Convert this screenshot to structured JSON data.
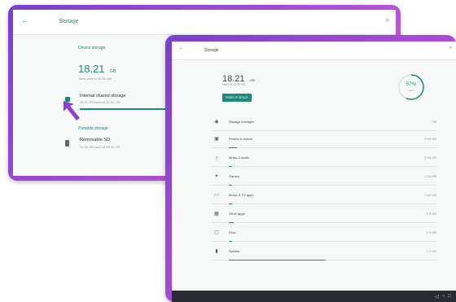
{
  "back_window": {
    "title": "Storage",
    "section_device": "Device storage",
    "used_value": "18.21",
    "used_unit": "GB",
    "used_caption": "Total used of 32.00 GB",
    "internal_title": "Internal shared storage",
    "internal_caption": "18.21 GB used of 32.00 GB",
    "section_portable": "Portable storage",
    "sd_title": "Removable SD",
    "sd_caption": "32.00 GB used of 64.00 GB"
  },
  "front_window": {
    "title": "Storage",
    "used_value": "18.21",
    "used_unit": "GB",
    "used_caption": "Used of 32.00 GB",
    "free_button": "FREE UP SPACE",
    "percent_value": "57%",
    "percent_caption": "Used",
    "manager_label": "Storage manager",
    "manager_toggle": "Off",
    "categories": [
      {
        "label": "Photos & videos",
        "value": "0.00 GB",
        "fill": 0.05
      },
      {
        "label": "Music & audio",
        "value": "0.00 GB",
        "fill": 0.02
      },
      {
        "label": "Games",
        "value": "0.00 GB",
        "fill": 0.02
      },
      {
        "label": "Movie & TV apps",
        "value": "0.00 GB",
        "fill": 0.02
      },
      {
        "label": "Other apps",
        "value": "1.5 GB",
        "fill": 0.03
      },
      {
        "label": "Files",
        "value": "0.0 GB",
        "fill": 0.02
      },
      {
        "label": "System",
        "value": "7.1 GB",
        "fill": 0.58
      }
    ]
  },
  "colors": {
    "accent": "#1b8a7a",
    "frame": "#a44bd2",
    "pointer": "#8a3fd8"
  },
  "icons": {
    "back": "back-arrow-icon",
    "search": "search-icon",
    "internal": "phone-storage-icon",
    "sd": "sd-card-icon",
    "pointer": "cursor-arrow-icon"
  }
}
